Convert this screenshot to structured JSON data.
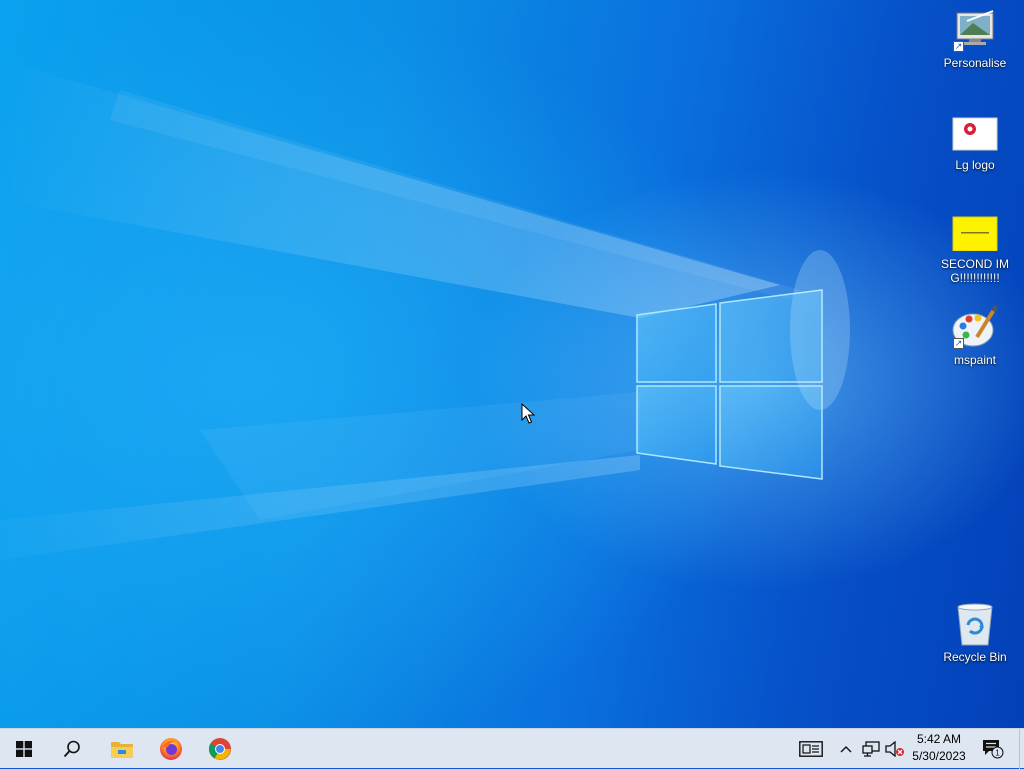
{
  "desktop": {
    "icons": [
      {
        "label": "Personalise",
        "icon": "personalise-shortcut-icon"
      },
      {
        "label": "Lg logo",
        "icon": "image-file-icon"
      },
      {
        "label": "SECOND IMG!!!!!!!!!!!!",
        "icon": "image-file-icon"
      },
      {
        "label": "mspaint",
        "icon": "paint-palette-icon"
      },
      {
        "label": "Recycle Bin",
        "icon": "recycle-bin-icon"
      }
    ]
  },
  "taskbar": {
    "start": {
      "icon": "windows-start-icon"
    },
    "search": {
      "icon": "search-icon"
    },
    "pinned": [
      {
        "name": "File Explorer",
        "icon": "file-explorer-icon"
      },
      {
        "name": "Firefox",
        "icon": "firefox-icon"
      },
      {
        "name": "Chrome",
        "icon": "chrome-icon"
      }
    ],
    "tray": {
      "news_icon": "news-widget-icon",
      "overflow_icon": "chevron-up-icon",
      "network_icon": "network-icon",
      "volume_icon": "volume-muted-icon"
    },
    "clock": {
      "time": "5:42 AM",
      "date": "5/30/2023"
    },
    "notifications": {
      "icon": "action-center-icon",
      "count": "1"
    }
  },
  "colors": {
    "wallpaper_light": "#0aa2ee",
    "wallpaper_dark": "#0340b8",
    "taskbar": "#dde6f1"
  }
}
